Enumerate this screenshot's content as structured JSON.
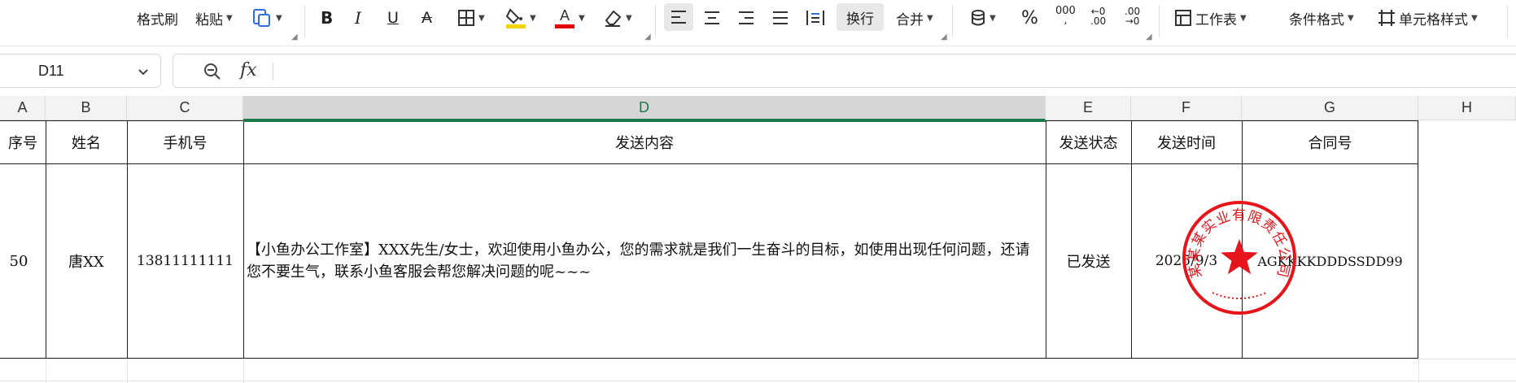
{
  "toolbar": {
    "format_painter": "格式刷",
    "paste": "粘贴",
    "wrap": "换行",
    "merge": "合并",
    "percent": "%",
    "thousands": "000",
    "decrease_decimal_top": "←0",
    "decrease_decimal_bottom": ".00",
    "increase_decimal_top": ".00",
    "increase_decimal_bottom": "→0",
    "worksheet": "工作表",
    "conditional_format": "条件格式",
    "cell_style": "单元格样式",
    "highlight_color": "#f2d500",
    "font_color": "#e00000"
  },
  "formula_bar": {
    "cell_ref": "D11",
    "fx_label": "fx",
    "formula": ""
  },
  "columns": [
    "A",
    "B",
    "C",
    "D",
    "E",
    "F",
    "G",
    "H"
  ],
  "selected_column": "D",
  "table": {
    "headers": [
      "序号",
      "姓名",
      "手机号",
      "发送内容",
      "发送状态",
      "发送时间",
      "合同号"
    ],
    "rows": [
      {
        "seq": "50",
        "name": "唐XX",
        "phone": "13811111111",
        "content": "【小鱼办公工作室】XXX先生/女士，欢迎使用小鱼办公，您的需求就是我们一生奋斗的目标，如使用出现任何问题，还请您不要生气，联系小鱼客服会帮您解决问题的呢~~~",
        "status": "已发送",
        "time": "2025/9/3",
        "contract": "AGKKKKDDDSSDD99"
      }
    ]
  },
  "seal": {
    "text": "某某某实业有限责任公司",
    "color": "#e8141b"
  },
  "colors": {
    "accent_green": "#1c7a4a",
    "header_bg": "#f3f3f3"
  }
}
